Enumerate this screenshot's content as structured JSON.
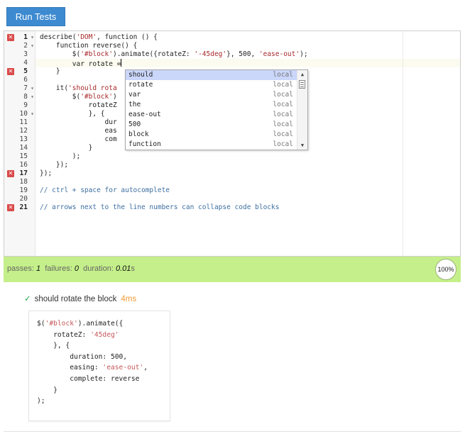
{
  "run_button": {
    "label": "Run Tests"
  },
  "editor": {
    "lines": [
      {
        "n": "1",
        "fold": "▾",
        "error": true,
        "html": "describe(<span class='s'>'DOM'</span>, function () {"
      },
      {
        "n": "2",
        "fold": "▾",
        "error": false,
        "html": "    function reverse() {"
      },
      {
        "n": "3",
        "fold": "",
        "error": false,
        "html": "        $(<span class='s'>'#block'</span>).animate({rotateZ: <span class='s'>'-45deg'</span>}, 500, <span class='s'>'ease-out'</span>);"
      },
      {
        "n": "4",
        "fold": "",
        "error": false,
        "html": "        var rotate =<span class='cursor'></span>"
      },
      {
        "n": "5",
        "fold": "",
        "error": true,
        "html": "    }"
      },
      {
        "n": "6",
        "fold": "",
        "error": false,
        "html": ""
      },
      {
        "n": "7",
        "fold": "▾",
        "error": false,
        "html": "    it(<span class='s'>'should rota</span>"
      },
      {
        "n": "8",
        "fold": "▾",
        "error": false,
        "html": "        $(<span class='s'>'#block'</span>)"
      },
      {
        "n": "9",
        "fold": "",
        "error": false,
        "html": "            rotateZ"
      },
      {
        "n": "10",
        "fold": "▾",
        "error": false,
        "html": "            }, {"
      },
      {
        "n": "11",
        "fold": "",
        "error": false,
        "html": "                dur"
      },
      {
        "n": "12",
        "fold": "",
        "error": false,
        "html": "                eas"
      },
      {
        "n": "13",
        "fold": "",
        "error": false,
        "html": "                com"
      },
      {
        "n": "14",
        "fold": "",
        "error": false,
        "html": "            }"
      },
      {
        "n": "15",
        "fold": "",
        "error": false,
        "html": "        );"
      },
      {
        "n": "16",
        "fold": "",
        "error": false,
        "html": "    });"
      },
      {
        "n": "17",
        "fold": "",
        "error": true,
        "html": "});"
      },
      {
        "n": "18",
        "fold": "",
        "error": false,
        "html": ""
      },
      {
        "n": "19",
        "fold": "",
        "error": false,
        "html": "<span class='cm'>// ctrl + space for autocomplete</span>"
      },
      {
        "n": "20",
        "fold": "",
        "error": false,
        "html": ""
      },
      {
        "n": "21",
        "fold": "",
        "error": true,
        "html": "<span class='cm'>// arrows next to the line numbers can collapse code blocks</span>"
      }
    ],
    "active_line": 4,
    "error_icon": "✕",
    "fold_icon": "chevron-down-icon"
  },
  "autocomplete": {
    "items": [
      {
        "caption": "should",
        "meta": "local",
        "selected": true
      },
      {
        "caption": "rotate",
        "meta": "local",
        "selected": false
      },
      {
        "caption": "var",
        "meta": "local",
        "selected": false
      },
      {
        "caption": "the",
        "meta": "local",
        "selected": false
      },
      {
        "caption": "ease-out",
        "meta": "local",
        "selected": false
      },
      {
        "caption": "500",
        "meta": "local",
        "selected": false
      },
      {
        "caption": "block",
        "meta": "local",
        "selected": false
      },
      {
        "caption": "function",
        "meta": "local",
        "selected": false
      }
    ],
    "scroll_up": "▲",
    "scroll_down": "▼"
  },
  "stats": {
    "passes_label": "passes:",
    "passes": "1",
    "failures_label": "failures:",
    "failures": "0",
    "duration_label": "duration:",
    "duration": "0.01",
    "duration_unit": "s",
    "progress_text": "100%",
    "progress": 1.0
  },
  "test": {
    "check": "✓",
    "title": "should rotate the block",
    "duration": "4ms",
    "code_html": "$(<span class='s'>'#block'</span>).animate({\n    rotateZ: <span class='s'>'45deg'</span>\n    }, {\n        duration: 500,\n        easing: <span class='s'>'ease-out'</span>,\n        complete: reverse\n    }\n);"
  },
  "colors": {
    "accent": "#3d8ad0",
    "status_bar": "#c4ef8a",
    "error": "#d94a4a",
    "pass": "#2aa44a",
    "duration": "#f29b34",
    "string": "#a8282a",
    "comment": "#3d6fa0",
    "autocomplete_selected": "#cad6fa"
  }
}
